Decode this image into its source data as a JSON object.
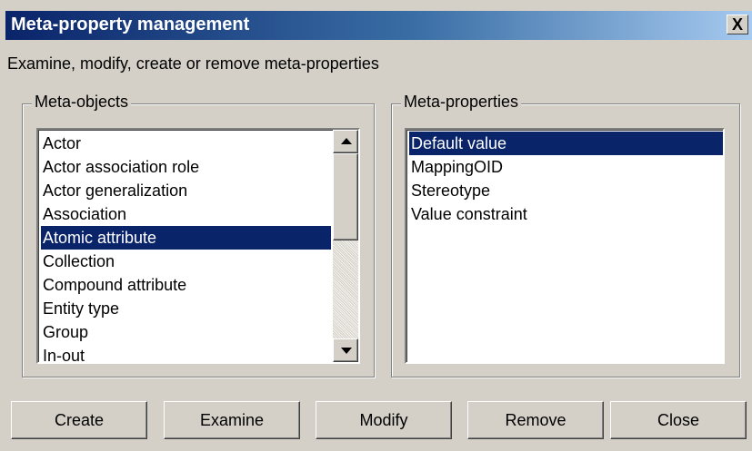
{
  "window": {
    "title": "Meta-property management",
    "close_glyph": "X"
  },
  "description": "Examine, modify, create or remove meta-properties",
  "meta_objects": {
    "legend": "Meta-objects",
    "items": [
      {
        "label": "Actor",
        "selected": false
      },
      {
        "label": "Actor association role",
        "selected": false
      },
      {
        "label": "Actor generalization",
        "selected": false
      },
      {
        "label": "Association",
        "selected": false
      },
      {
        "label": "Atomic attribute",
        "selected": true
      },
      {
        "label": "Collection",
        "selected": false
      },
      {
        "label": "Compound attribute",
        "selected": false
      },
      {
        "label": "Entity type",
        "selected": false
      },
      {
        "label": "Group",
        "selected": false
      },
      {
        "label": "In-out",
        "selected": false
      }
    ]
  },
  "meta_properties": {
    "legend": "Meta-properties",
    "items": [
      {
        "label": "Default value",
        "selected": true
      },
      {
        "label": "MappingOID",
        "selected": false
      },
      {
        "label": "Stereotype",
        "selected": false
      },
      {
        "label": "Value constraint",
        "selected": false
      }
    ]
  },
  "buttons": {
    "create": "Create",
    "examine": "Examine",
    "modify": "Modify",
    "remove": "Remove",
    "close": "Close"
  },
  "colors": {
    "selection": "#0a246a",
    "face": "#d4d0c8",
    "title_start": "#0a246a",
    "title_end": "#a6caf0"
  }
}
